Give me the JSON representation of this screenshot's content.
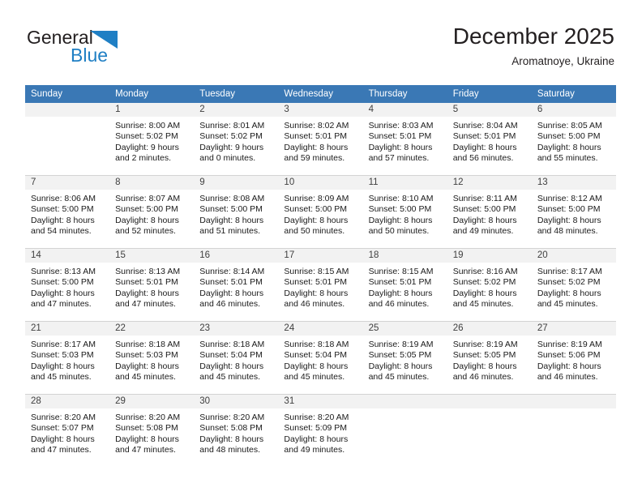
{
  "brand": {
    "name_top": "General",
    "name_bottom": "Blue",
    "mark": "triangle-logo",
    "color_blue": "#1f7fc4",
    "color_dark": "#231f20"
  },
  "header": {
    "title": "December 2025",
    "subtitle": "Aromatnoye, Ukraine"
  },
  "theme": {
    "header_bg": "#3a78b5",
    "daynum_bg": "#f2f2f2",
    "grid_line": "#d3d3d3"
  },
  "weekday_headers": [
    "Sunday",
    "Monday",
    "Tuesday",
    "Wednesday",
    "Thursday",
    "Friday",
    "Saturday"
  ],
  "weeks": [
    [
      {
        "day": "",
        "sunrise": "",
        "sunset": "",
        "daylight1": "",
        "daylight2": ""
      },
      {
        "day": "1",
        "sunrise": "Sunrise: 8:00 AM",
        "sunset": "Sunset: 5:02 PM",
        "daylight1": "Daylight: 9 hours",
        "daylight2": "and 2 minutes."
      },
      {
        "day": "2",
        "sunrise": "Sunrise: 8:01 AM",
        "sunset": "Sunset: 5:02 PM",
        "daylight1": "Daylight: 9 hours",
        "daylight2": "and 0 minutes."
      },
      {
        "day": "3",
        "sunrise": "Sunrise: 8:02 AM",
        "sunset": "Sunset: 5:01 PM",
        "daylight1": "Daylight: 8 hours",
        "daylight2": "and 59 minutes."
      },
      {
        "day": "4",
        "sunrise": "Sunrise: 8:03 AM",
        "sunset": "Sunset: 5:01 PM",
        "daylight1": "Daylight: 8 hours",
        "daylight2": "and 57 minutes."
      },
      {
        "day": "5",
        "sunrise": "Sunrise: 8:04 AM",
        "sunset": "Sunset: 5:01 PM",
        "daylight1": "Daylight: 8 hours",
        "daylight2": "and 56 minutes."
      },
      {
        "day": "6",
        "sunrise": "Sunrise: 8:05 AM",
        "sunset": "Sunset: 5:00 PM",
        "daylight1": "Daylight: 8 hours",
        "daylight2": "and 55 minutes."
      }
    ],
    [
      {
        "day": "7",
        "sunrise": "Sunrise: 8:06 AM",
        "sunset": "Sunset: 5:00 PM",
        "daylight1": "Daylight: 8 hours",
        "daylight2": "and 54 minutes."
      },
      {
        "day": "8",
        "sunrise": "Sunrise: 8:07 AM",
        "sunset": "Sunset: 5:00 PM",
        "daylight1": "Daylight: 8 hours",
        "daylight2": "and 52 minutes."
      },
      {
        "day": "9",
        "sunrise": "Sunrise: 8:08 AM",
        "sunset": "Sunset: 5:00 PM",
        "daylight1": "Daylight: 8 hours",
        "daylight2": "and 51 minutes."
      },
      {
        "day": "10",
        "sunrise": "Sunrise: 8:09 AM",
        "sunset": "Sunset: 5:00 PM",
        "daylight1": "Daylight: 8 hours",
        "daylight2": "and 50 minutes."
      },
      {
        "day": "11",
        "sunrise": "Sunrise: 8:10 AM",
        "sunset": "Sunset: 5:00 PM",
        "daylight1": "Daylight: 8 hours",
        "daylight2": "and 50 minutes."
      },
      {
        "day": "12",
        "sunrise": "Sunrise: 8:11 AM",
        "sunset": "Sunset: 5:00 PM",
        "daylight1": "Daylight: 8 hours",
        "daylight2": "and 49 minutes."
      },
      {
        "day": "13",
        "sunrise": "Sunrise: 8:12 AM",
        "sunset": "Sunset: 5:00 PM",
        "daylight1": "Daylight: 8 hours",
        "daylight2": "and 48 minutes."
      }
    ],
    [
      {
        "day": "14",
        "sunrise": "Sunrise: 8:13 AM",
        "sunset": "Sunset: 5:00 PM",
        "daylight1": "Daylight: 8 hours",
        "daylight2": "and 47 minutes."
      },
      {
        "day": "15",
        "sunrise": "Sunrise: 8:13 AM",
        "sunset": "Sunset: 5:01 PM",
        "daylight1": "Daylight: 8 hours",
        "daylight2": "and 47 minutes."
      },
      {
        "day": "16",
        "sunrise": "Sunrise: 8:14 AM",
        "sunset": "Sunset: 5:01 PM",
        "daylight1": "Daylight: 8 hours",
        "daylight2": "and 46 minutes."
      },
      {
        "day": "17",
        "sunrise": "Sunrise: 8:15 AM",
        "sunset": "Sunset: 5:01 PM",
        "daylight1": "Daylight: 8 hours",
        "daylight2": "and 46 minutes."
      },
      {
        "day": "18",
        "sunrise": "Sunrise: 8:15 AM",
        "sunset": "Sunset: 5:01 PM",
        "daylight1": "Daylight: 8 hours",
        "daylight2": "and 46 minutes."
      },
      {
        "day": "19",
        "sunrise": "Sunrise: 8:16 AM",
        "sunset": "Sunset: 5:02 PM",
        "daylight1": "Daylight: 8 hours",
        "daylight2": "and 45 minutes."
      },
      {
        "day": "20",
        "sunrise": "Sunrise: 8:17 AM",
        "sunset": "Sunset: 5:02 PM",
        "daylight1": "Daylight: 8 hours",
        "daylight2": "and 45 minutes."
      }
    ],
    [
      {
        "day": "21",
        "sunrise": "Sunrise: 8:17 AM",
        "sunset": "Sunset: 5:03 PM",
        "daylight1": "Daylight: 8 hours",
        "daylight2": "and 45 minutes."
      },
      {
        "day": "22",
        "sunrise": "Sunrise: 8:18 AM",
        "sunset": "Sunset: 5:03 PM",
        "daylight1": "Daylight: 8 hours",
        "daylight2": "and 45 minutes."
      },
      {
        "day": "23",
        "sunrise": "Sunrise: 8:18 AM",
        "sunset": "Sunset: 5:04 PM",
        "daylight1": "Daylight: 8 hours",
        "daylight2": "and 45 minutes."
      },
      {
        "day": "24",
        "sunrise": "Sunrise: 8:18 AM",
        "sunset": "Sunset: 5:04 PM",
        "daylight1": "Daylight: 8 hours",
        "daylight2": "and 45 minutes."
      },
      {
        "day": "25",
        "sunrise": "Sunrise: 8:19 AM",
        "sunset": "Sunset: 5:05 PM",
        "daylight1": "Daylight: 8 hours",
        "daylight2": "and 45 minutes."
      },
      {
        "day": "26",
        "sunrise": "Sunrise: 8:19 AM",
        "sunset": "Sunset: 5:05 PM",
        "daylight1": "Daylight: 8 hours",
        "daylight2": "and 46 minutes."
      },
      {
        "day": "27",
        "sunrise": "Sunrise: 8:19 AM",
        "sunset": "Sunset: 5:06 PM",
        "daylight1": "Daylight: 8 hours",
        "daylight2": "and 46 minutes."
      }
    ],
    [
      {
        "day": "28",
        "sunrise": "Sunrise: 8:20 AM",
        "sunset": "Sunset: 5:07 PM",
        "daylight1": "Daylight: 8 hours",
        "daylight2": "and 47 minutes."
      },
      {
        "day": "29",
        "sunrise": "Sunrise: 8:20 AM",
        "sunset": "Sunset: 5:08 PM",
        "daylight1": "Daylight: 8 hours",
        "daylight2": "and 47 minutes."
      },
      {
        "day": "30",
        "sunrise": "Sunrise: 8:20 AM",
        "sunset": "Sunset: 5:08 PM",
        "daylight1": "Daylight: 8 hours",
        "daylight2": "and 48 minutes."
      },
      {
        "day": "31",
        "sunrise": "Sunrise: 8:20 AM",
        "sunset": "Sunset: 5:09 PM",
        "daylight1": "Daylight: 8 hours",
        "daylight2": "and 49 minutes."
      },
      {
        "day": "",
        "sunrise": "",
        "sunset": "",
        "daylight1": "",
        "daylight2": ""
      },
      {
        "day": "",
        "sunrise": "",
        "sunset": "",
        "daylight1": "",
        "daylight2": ""
      },
      {
        "day": "",
        "sunrise": "",
        "sunset": "",
        "daylight1": "",
        "daylight2": ""
      }
    ]
  ]
}
